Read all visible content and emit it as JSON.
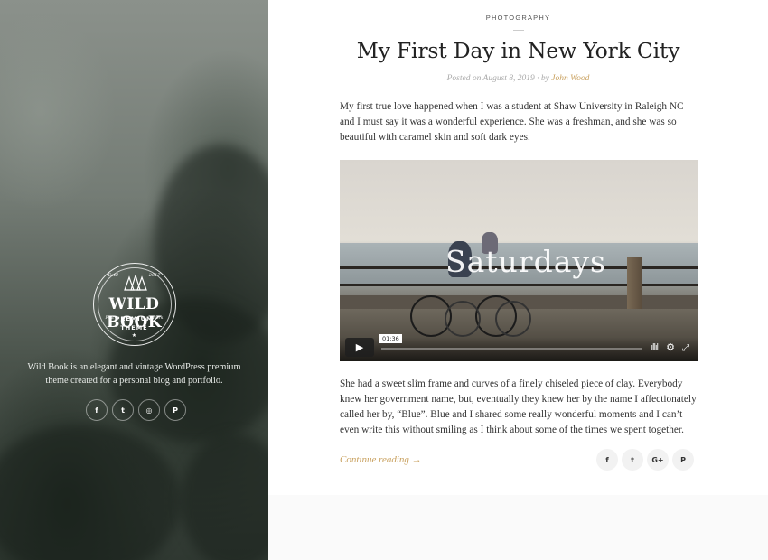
{
  "sidebar": {
    "logo": {
      "name": "WILD BOOK",
      "sub1": "PREMIUM",
      "sub2": "THEME",
      "est_left": "Estd",
      "est_right": "2017",
      "side_left": "Fast",
      "side_right": "Work",
      "star": "★"
    },
    "tagline": "Wild Book is an elegant and vintage WordPress premium theme created for a personal blog and portfolio.",
    "social": [
      {
        "icon": "facebook-icon",
        "glyph": "f"
      },
      {
        "icon": "twitter-icon",
        "glyph": "t"
      },
      {
        "icon": "instagram-icon",
        "glyph": "◎"
      },
      {
        "icon": "pinterest-icon",
        "glyph": "P"
      }
    ]
  },
  "post": {
    "category": "PHOTOGRAPHY",
    "title": "My First Day in New York City",
    "meta": {
      "posted_on": "Posted on August 8, 2019",
      "separator": "·",
      "by": "by",
      "author": "John Wood"
    },
    "paragraph1": "My first true love happened when I was a student at Shaw University in Raleigh NC and I must say it was a wonderful experience. She was a freshman, and she was so beautiful with caramel skin and soft dark eyes.",
    "video": {
      "overlay_title": "Saturdays",
      "timecode": "01:36",
      "play_glyph": "▶",
      "volume_glyph": "ıllıl",
      "settings_glyph": "⚙",
      "fullscreen_glyph": "⤢"
    },
    "paragraph2": "She had a sweet slim frame and curves of a finely chiseled piece of clay. Everybody knew her government name, but, eventually they knew her by the name I affectionately called her by, “Blue”. Blue and I shared some really wonderful moments and I can’t even write this without smiling as I think about some of the times we spent together.",
    "continue_reading": "Continue reading →",
    "share": [
      {
        "icon": "facebook-icon",
        "glyph": "f"
      },
      {
        "icon": "twitter-icon",
        "glyph": "t"
      },
      {
        "icon": "google-plus-icon",
        "glyph": "G+"
      },
      {
        "icon": "pinterest-icon",
        "glyph": "P"
      }
    ]
  },
  "colors": {
    "accent": "#c9a15f",
    "text": "#333333",
    "meta": "#aaaaaa"
  }
}
